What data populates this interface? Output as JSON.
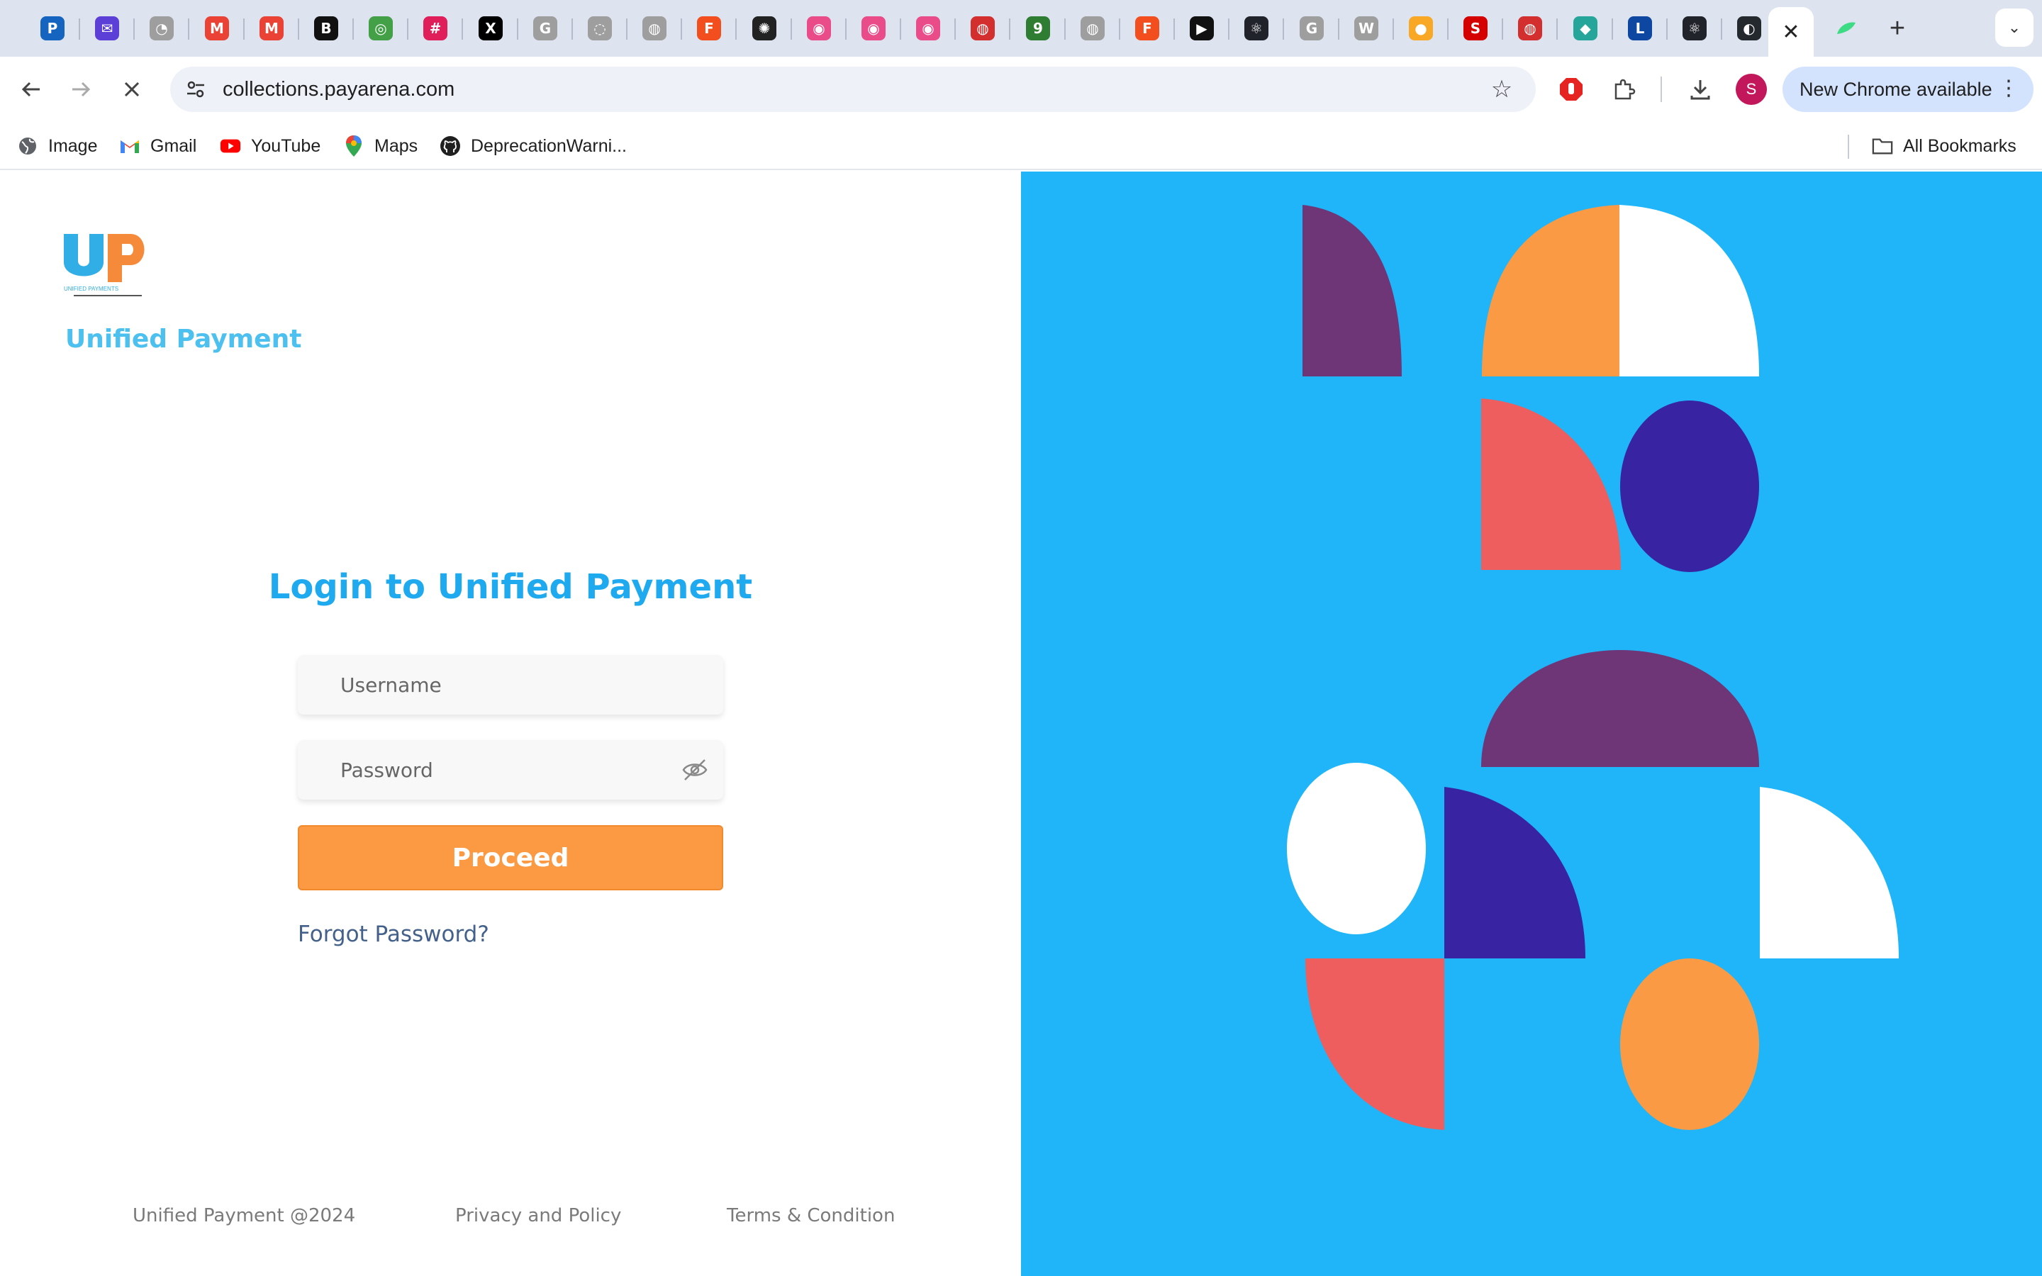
{
  "browser": {
    "tabs": [
      {
        "name": "tab-payarena",
        "glyph": "P",
        "bg": "#1565c0"
      },
      {
        "name": "tab-mail",
        "glyph": "✉",
        "bg": "#5b3fd6"
      },
      {
        "name": "tab-app",
        "glyph": "◔",
        "bg": "#9e9e9e"
      },
      {
        "name": "tab-gmail-1",
        "glyph": "M",
        "bg": "#ea4335"
      },
      {
        "name": "tab-gmail-2",
        "glyph": "M",
        "bg": "#ea4335"
      },
      {
        "name": "tab-b",
        "glyph": "B",
        "bg": "#111111"
      },
      {
        "name": "tab-green",
        "glyph": "◎",
        "bg": "#43a047"
      },
      {
        "name": "tab-slack",
        "glyph": "#",
        "bg": "#e01e5a"
      },
      {
        "name": "tab-x",
        "glyph": "X",
        "bg": "#000000"
      },
      {
        "name": "tab-google-1",
        "glyph": "G",
        "bg": "#9e9e9e"
      },
      {
        "name": "tab-site",
        "glyph": "◌",
        "bg": "#9e9e9e"
      },
      {
        "name": "tab-figma-like",
        "glyph": "◍",
        "bg": "#9e9e9e"
      },
      {
        "name": "tab-figma-1",
        "glyph": "F",
        "bg": "#f24e1e"
      },
      {
        "name": "tab-chatgpt",
        "glyph": "✺",
        "bg": "#222222"
      },
      {
        "name": "tab-dribbble-1",
        "glyph": "◉",
        "bg": "#ea4c89"
      },
      {
        "name": "tab-dribbble-2",
        "glyph": "◉",
        "bg": "#ea4c89"
      },
      {
        "name": "tab-dribbble-3",
        "glyph": "◉",
        "bg": "#ea4c89"
      },
      {
        "name": "tab-red-circle",
        "glyph": "◍",
        "bg": "#d32f2f"
      },
      {
        "name": "tab-9ja",
        "glyph": "9",
        "bg": "#2e7d32"
      },
      {
        "name": "tab-site-2",
        "glyph": "◍",
        "bg": "#9e9e9e"
      },
      {
        "name": "tab-figma-2",
        "glyph": "F",
        "bg": "#f24e1e"
      },
      {
        "name": "tab-play",
        "glyph": "▶",
        "bg": "#111111"
      },
      {
        "name": "tab-react-1",
        "glyph": "⚛",
        "bg": "#20232a"
      },
      {
        "name": "tab-google-2",
        "glyph": "G",
        "bg": "#9e9e9e"
      },
      {
        "name": "tab-wikipedia",
        "glyph": "W",
        "bg": "#9e9e9e"
      },
      {
        "name": "tab-bank",
        "glyph": "●",
        "bg": "#f9a825"
      },
      {
        "name": "tab-s-red",
        "glyph": "S",
        "bg": "#d50000"
      },
      {
        "name": "tab-red-circle-2",
        "glyph": "◍",
        "bg": "#d32f2f"
      },
      {
        "name": "tab-diamond",
        "glyph": "◆",
        "bg": "#26a69a"
      },
      {
        "name": "tab-live",
        "glyph": "L",
        "bg": "#0d47a1"
      },
      {
        "name": "tab-react-2",
        "glyph": "⚛",
        "bg": "#20232a"
      },
      {
        "name": "tab-github",
        "glyph": "◐",
        "bg": "#24292e"
      }
    ],
    "active_tab_close": "✕",
    "new_tab_glyph": "+",
    "tab_search_glyph": "⌄",
    "url": "collections.payarena.com",
    "new_chrome_label": "New Chrome available",
    "profile_initial": "S"
  },
  "bookmarks": {
    "items": [
      {
        "label": "Image"
      },
      {
        "label": "Gmail"
      },
      {
        "label": "YouTube"
      },
      {
        "label": "Maps"
      },
      {
        "label": "DeprecationWarni..."
      }
    ],
    "all_bookmarks": "All Bookmarks"
  },
  "brand": {
    "logo_letters": "UP",
    "logo_caption": "UNIFIED PAYMENTS",
    "name": "Unified Payment"
  },
  "login": {
    "title": "Login to Unified Payment",
    "username_placeholder": "Username",
    "password_placeholder": "Password",
    "proceed_label": "Proceed",
    "forgot_label": "Forgot Password?"
  },
  "footer": {
    "copyright": "Unified Payment @2024",
    "privacy": "Privacy and Policy",
    "terms": "Terms & Condition"
  },
  "colors": {
    "accent_blue": "#1faaf0",
    "panel_blue": "#1fb5f8",
    "button_orange": "#fc9a44",
    "shape_purple": "#6e3677",
    "shape_orange": "#fb9a44",
    "shape_white": "#ffffff",
    "shape_coral": "#ee5e5e",
    "shape_indigo": "#3823a2"
  }
}
